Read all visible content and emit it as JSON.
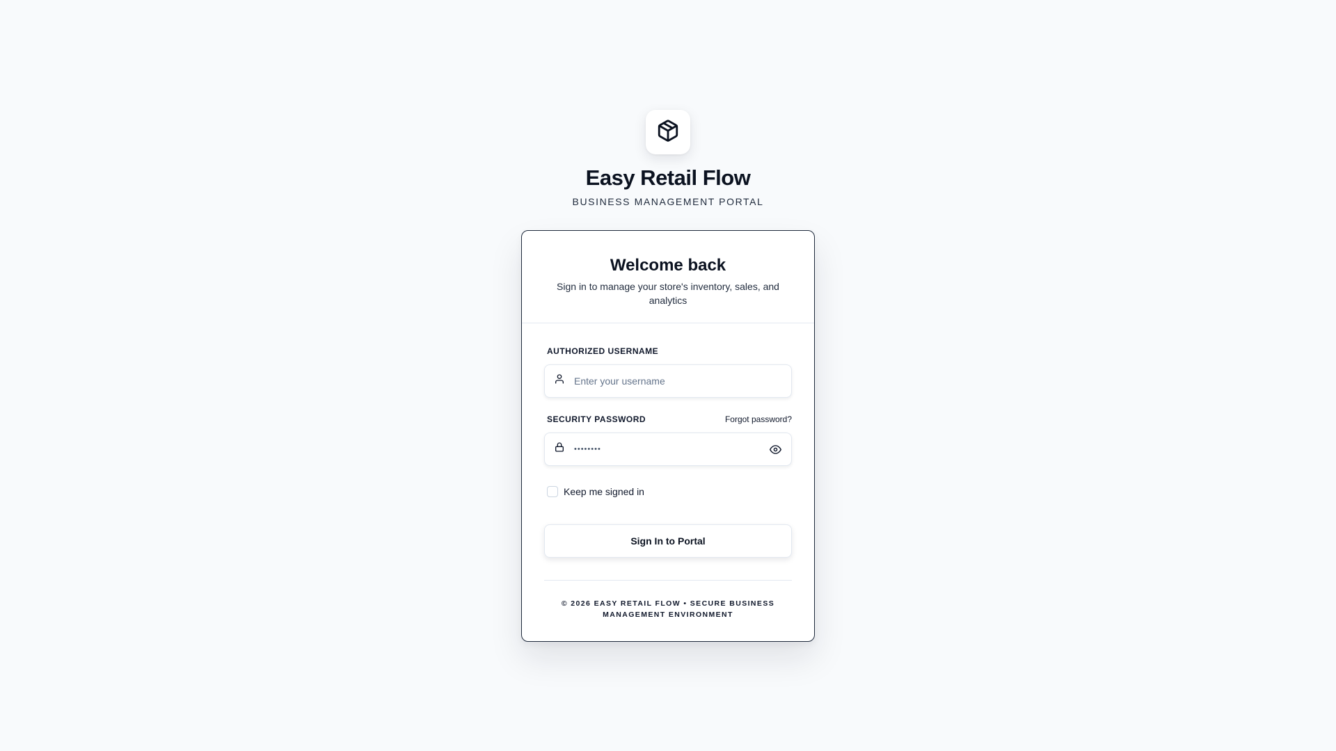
{
  "brand": {
    "logo_icon": "package-cube-icon",
    "title": "Easy Retail Flow",
    "subtitle": "BUSINESS MANAGEMENT PORTAL"
  },
  "card": {
    "heading": "Welcome back",
    "description": "Sign in to manage your store's inventory, sales, and analytics"
  },
  "username": {
    "label": "AUTHORIZED USERNAME",
    "icon": "user-icon",
    "placeholder": "Enter your username",
    "value": ""
  },
  "password": {
    "label": "SECURITY PASSWORD",
    "icon": "lock-icon",
    "forgot_label": "Forgot password?",
    "masked_value": "••••••••",
    "toggle_icon": "eye-icon"
  },
  "remember": {
    "label": "Keep me signed in",
    "checked": false
  },
  "submit": {
    "label": "Sign In to Portal"
  },
  "footer": {
    "text": "© 2026 EASY RETAIL FLOW • SECURE BUSINESS MANAGEMENT ENVIRONMENT"
  },
  "colors": {
    "background": "#f8fafc",
    "card_border": "#1e293b",
    "text_primary": "#0b1220",
    "placeholder": "#64748b",
    "divider": "#e2e8f0"
  }
}
